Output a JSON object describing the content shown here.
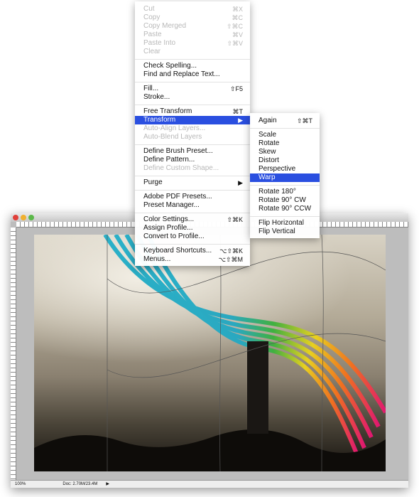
{
  "edit_menu": {
    "items": [
      {
        "label": "Cut",
        "shortcut": "⌘X",
        "disabled": true
      },
      {
        "label": "Copy",
        "shortcut": "⌘C",
        "disabled": true
      },
      {
        "label": "Copy Merged",
        "shortcut": "⇧⌘C",
        "disabled": true
      },
      {
        "label": "Paste",
        "shortcut": "⌘V",
        "disabled": true
      },
      {
        "label": "Paste Into",
        "shortcut": "⇧⌘V",
        "disabled": true
      },
      {
        "label": "Clear",
        "shortcut": "",
        "disabled": true
      },
      {
        "sep": true
      },
      {
        "label": "Check Spelling...",
        "shortcut": ""
      },
      {
        "label": "Find and Replace Text...",
        "shortcut": ""
      },
      {
        "sep": true
      },
      {
        "label": "Fill...",
        "shortcut": "⇧F5"
      },
      {
        "label": "Stroke...",
        "shortcut": ""
      },
      {
        "sep": true
      },
      {
        "label": "Free Transform",
        "shortcut": "⌘T"
      },
      {
        "label": "Transform",
        "shortcut": "▶",
        "highlighted": true
      },
      {
        "label": "Auto-Align Layers...",
        "shortcut": "",
        "disabled": true
      },
      {
        "label": "Auto-Blend Layers",
        "shortcut": "",
        "disabled": true
      },
      {
        "sep": true
      },
      {
        "label": "Define Brush Preset...",
        "shortcut": ""
      },
      {
        "label": "Define Pattern...",
        "shortcut": ""
      },
      {
        "label": "Define Custom Shape...",
        "shortcut": "",
        "disabled": true
      },
      {
        "sep": true
      },
      {
        "label": "Purge",
        "shortcut": "▶"
      },
      {
        "sep": true
      },
      {
        "label": "Adobe PDF Presets...",
        "shortcut": ""
      },
      {
        "label": "Preset Manager...",
        "shortcut": ""
      },
      {
        "sep": true
      },
      {
        "label": "Color Settings...",
        "shortcut": "⇧⌘K"
      },
      {
        "label": "Assign Profile...",
        "shortcut": ""
      },
      {
        "label": "Convert to Profile...",
        "shortcut": ""
      },
      {
        "sep": true
      },
      {
        "label": "Keyboard Shortcuts...",
        "shortcut": "⌥⇧⌘K"
      },
      {
        "label": "Menus...",
        "shortcut": "⌥⇧⌘M"
      }
    ]
  },
  "transform_submenu": {
    "items": [
      {
        "label": "Again",
        "shortcut": "⇧⌘T"
      },
      {
        "sep": true
      },
      {
        "label": "Scale",
        "shortcut": ""
      },
      {
        "label": "Rotate",
        "shortcut": ""
      },
      {
        "label": "Skew",
        "shortcut": ""
      },
      {
        "label": "Distort",
        "shortcut": ""
      },
      {
        "label": "Perspective",
        "shortcut": ""
      },
      {
        "label": "Warp",
        "shortcut": "",
        "highlighted": true
      },
      {
        "sep": true
      },
      {
        "label": "Rotate 180°",
        "shortcut": ""
      },
      {
        "label": "Rotate 90° CW",
        "shortcut": ""
      },
      {
        "label": "Rotate 90° CCW",
        "shortcut": ""
      },
      {
        "sep": true
      },
      {
        "label": "Flip Horizontal",
        "shortcut": ""
      },
      {
        "label": "Flip Vertical",
        "shortcut": ""
      }
    ]
  },
  "document": {
    "zoom": "100%",
    "doc_info": "Doc: 2.70M/23.4M"
  },
  "colors": {
    "highlight": "#2a4fe0"
  }
}
